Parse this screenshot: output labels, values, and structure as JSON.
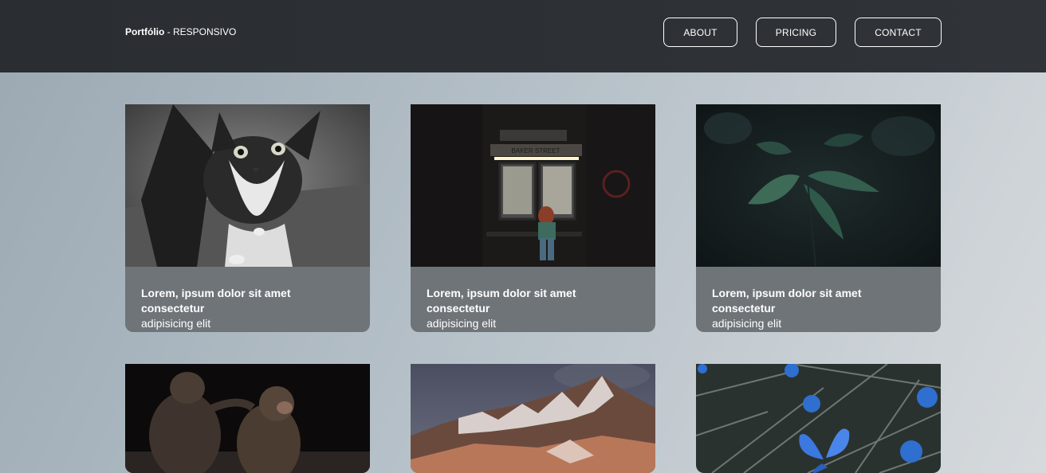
{
  "header": {
    "brand_bold": "Portfólio",
    "brand_rest": " - RESPONSIVO",
    "nav": [
      {
        "label": "ABOUT"
      },
      {
        "label": "PRICING"
      },
      {
        "label": "CONTACT"
      }
    ]
  },
  "cards": [
    {
      "title": "Lorem, ipsum dolor sit amet consectetur",
      "subtitle": "adipisicing elit",
      "image": "cat-photo"
    },
    {
      "title": "Lorem, ipsum dolor sit amet consectetur",
      "subtitle": "adipisicing elit",
      "image": "subway-person-photo",
      "sign_text": "BAKER STREET"
    },
    {
      "title": "Lorem, ipsum dolor sit amet consectetur",
      "subtitle": "adipisicing elit",
      "image": "leaves-photo"
    },
    {
      "image": "monkeys-photo"
    },
    {
      "image": "mountain-photo"
    },
    {
      "image": "butterfly-flowers-photo"
    }
  ]
}
